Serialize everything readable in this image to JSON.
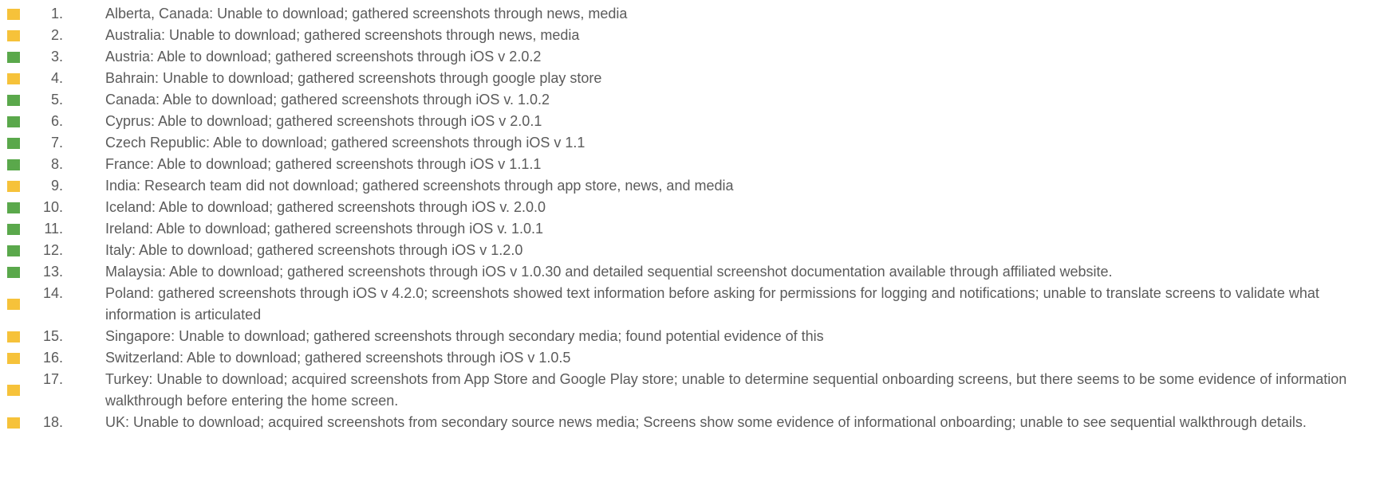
{
  "colors": {
    "text": "#5b5b5b",
    "yellow_bullet": "#f6c23a",
    "green_bullet": "#5aa84b"
  },
  "items": [
    {
      "num": "1.",
      "status": "yellow",
      "text": "Alberta, Canada: Unable to download; gathered screenshots through news, media"
    },
    {
      "num": "2.",
      "status": "yellow",
      "text": "Australia: Unable to download; gathered screenshots through news, media"
    },
    {
      "num": "3.",
      "status": "green",
      "text": "Austria: Able to download; gathered screenshots through iOS v 2.0.2"
    },
    {
      "num": "4.",
      "status": "yellow",
      "text": "Bahrain: Unable to download; gathered screenshots through google play store"
    },
    {
      "num": "5.",
      "status": "green",
      "text": "Canada: Able to download; gathered screenshots through iOS v. 1.0.2"
    },
    {
      "num": "6.",
      "status": "green",
      "text": "Cyprus: Able to download; gathered screenshots through iOS v 2.0.1"
    },
    {
      "num": "7.",
      "status": "green",
      "text": "Czech Republic: Able to download; gathered screenshots through iOS v 1.1"
    },
    {
      "num": "8.",
      "status": "green",
      "text": "France: Able to download; gathered screenshots through iOS v 1.1.1"
    },
    {
      "num": "9.",
      "status": "yellow",
      "text": "India: Research team did not download; gathered screenshots through app store, news, and media"
    },
    {
      "num": "10.",
      "status": "green",
      "text": "Iceland: Able to download; gathered screenshots through iOS v. 2.0.0"
    },
    {
      "num": "11.",
      "status": "green",
      "text": "Ireland: Able to download; gathered screenshots through iOS v. 1.0.1"
    },
    {
      "num": "12.",
      "status": "green",
      "text": "Italy: Able to download; gathered screenshots through iOS v 1.2.0"
    },
    {
      "num": "13.",
      "status": "green",
      "text": "Malaysia: Able to download; gathered screenshots through iOS v 1.0.30 and detailed sequential screenshot documentation available through affiliated website."
    },
    {
      "num": "14.",
      "status": "yellow",
      "text": "Poland: gathered screenshots through iOS v 4.2.0; screenshots showed text information before asking for permissions for logging and notifications; unable to translate screens to validate what information is articulated"
    },
    {
      "num": "15.",
      "status": "yellow",
      "text": "Singapore: Unable to download; gathered screenshots through secondary media; found potential evidence of this"
    },
    {
      "num": "16.",
      "status": "yellow",
      "text": "Switzerland: Able to download; gathered screenshots through iOS v 1.0.5"
    },
    {
      "num": "17.",
      "status": "yellow",
      "text": "Turkey: Unable to download; acquired screenshots from App Store and Google Play store; unable to determine sequential onboarding screens, but there seems to be some evidence of information walkthrough before entering the home screen."
    },
    {
      "num": "18.",
      "status": "yellow",
      "text": "UK: Unable to download; acquired screenshots from secondary source news media; Screens show some evidence of informational onboarding; unable to see sequential walkthrough details."
    }
  ]
}
